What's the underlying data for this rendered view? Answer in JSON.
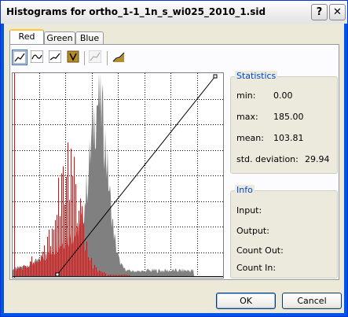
{
  "window": {
    "title": "Histograms for ortho_1-1_1n_s_wi025_2010_1.sid",
    "help_glyph": "?",
    "close_glyph": "✕"
  },
  "tabs": [
    {
      "label": "Red",
      "active": true
    },
    {
      "label": "Green",
      "active": false
    },
    {
      "label": "Blue",
      "active": false
    }
  ],
  "toolbar": [
    {
      "icon": "linear-stretch-icon",
      "pressed": true
    },
    {
      "icon": "curve-icon",
      "pressed": false
    },
    {
      "icon": "gamma-curve-icon",
      "pressed": false
    },
    {
      "icon": "histogram-equalize-icon",
      "pressed": false
    },
    {
      "icon": "custom-curve-icon",
      "pressed": false,
      "disabled": true
    },
    {
      "icon": "auto-stretch-icon",
      "pressed": false
    }
  ],
  "statistics": {
    "title": "Statistics",
    "min_label": "min:",
    "min": "0.00",
    "max_label": "max:",
    "max": "185.00",
    "mean_label": "mean:",
    "mean": "103.81",
    "std_label": "std. deviation:",
    "std": "29.94"
  },
  "info": {
    "title": "Info",
    "input_label": "Input:",
    "output_label": "Output:",
    "count_out_label": "Count Out:",
    "count_in_label": "Count In:"
  },
  "buttons": {
    "ok": "OK",
    "cancel": "Cancel"
  },
  "colors": {
    "red_histogram": "#ff0000",
    "gray_histogram": "#808080",
    "grid": "#000000",
    "tab_highlight": "#ffc83c"
  }
}
